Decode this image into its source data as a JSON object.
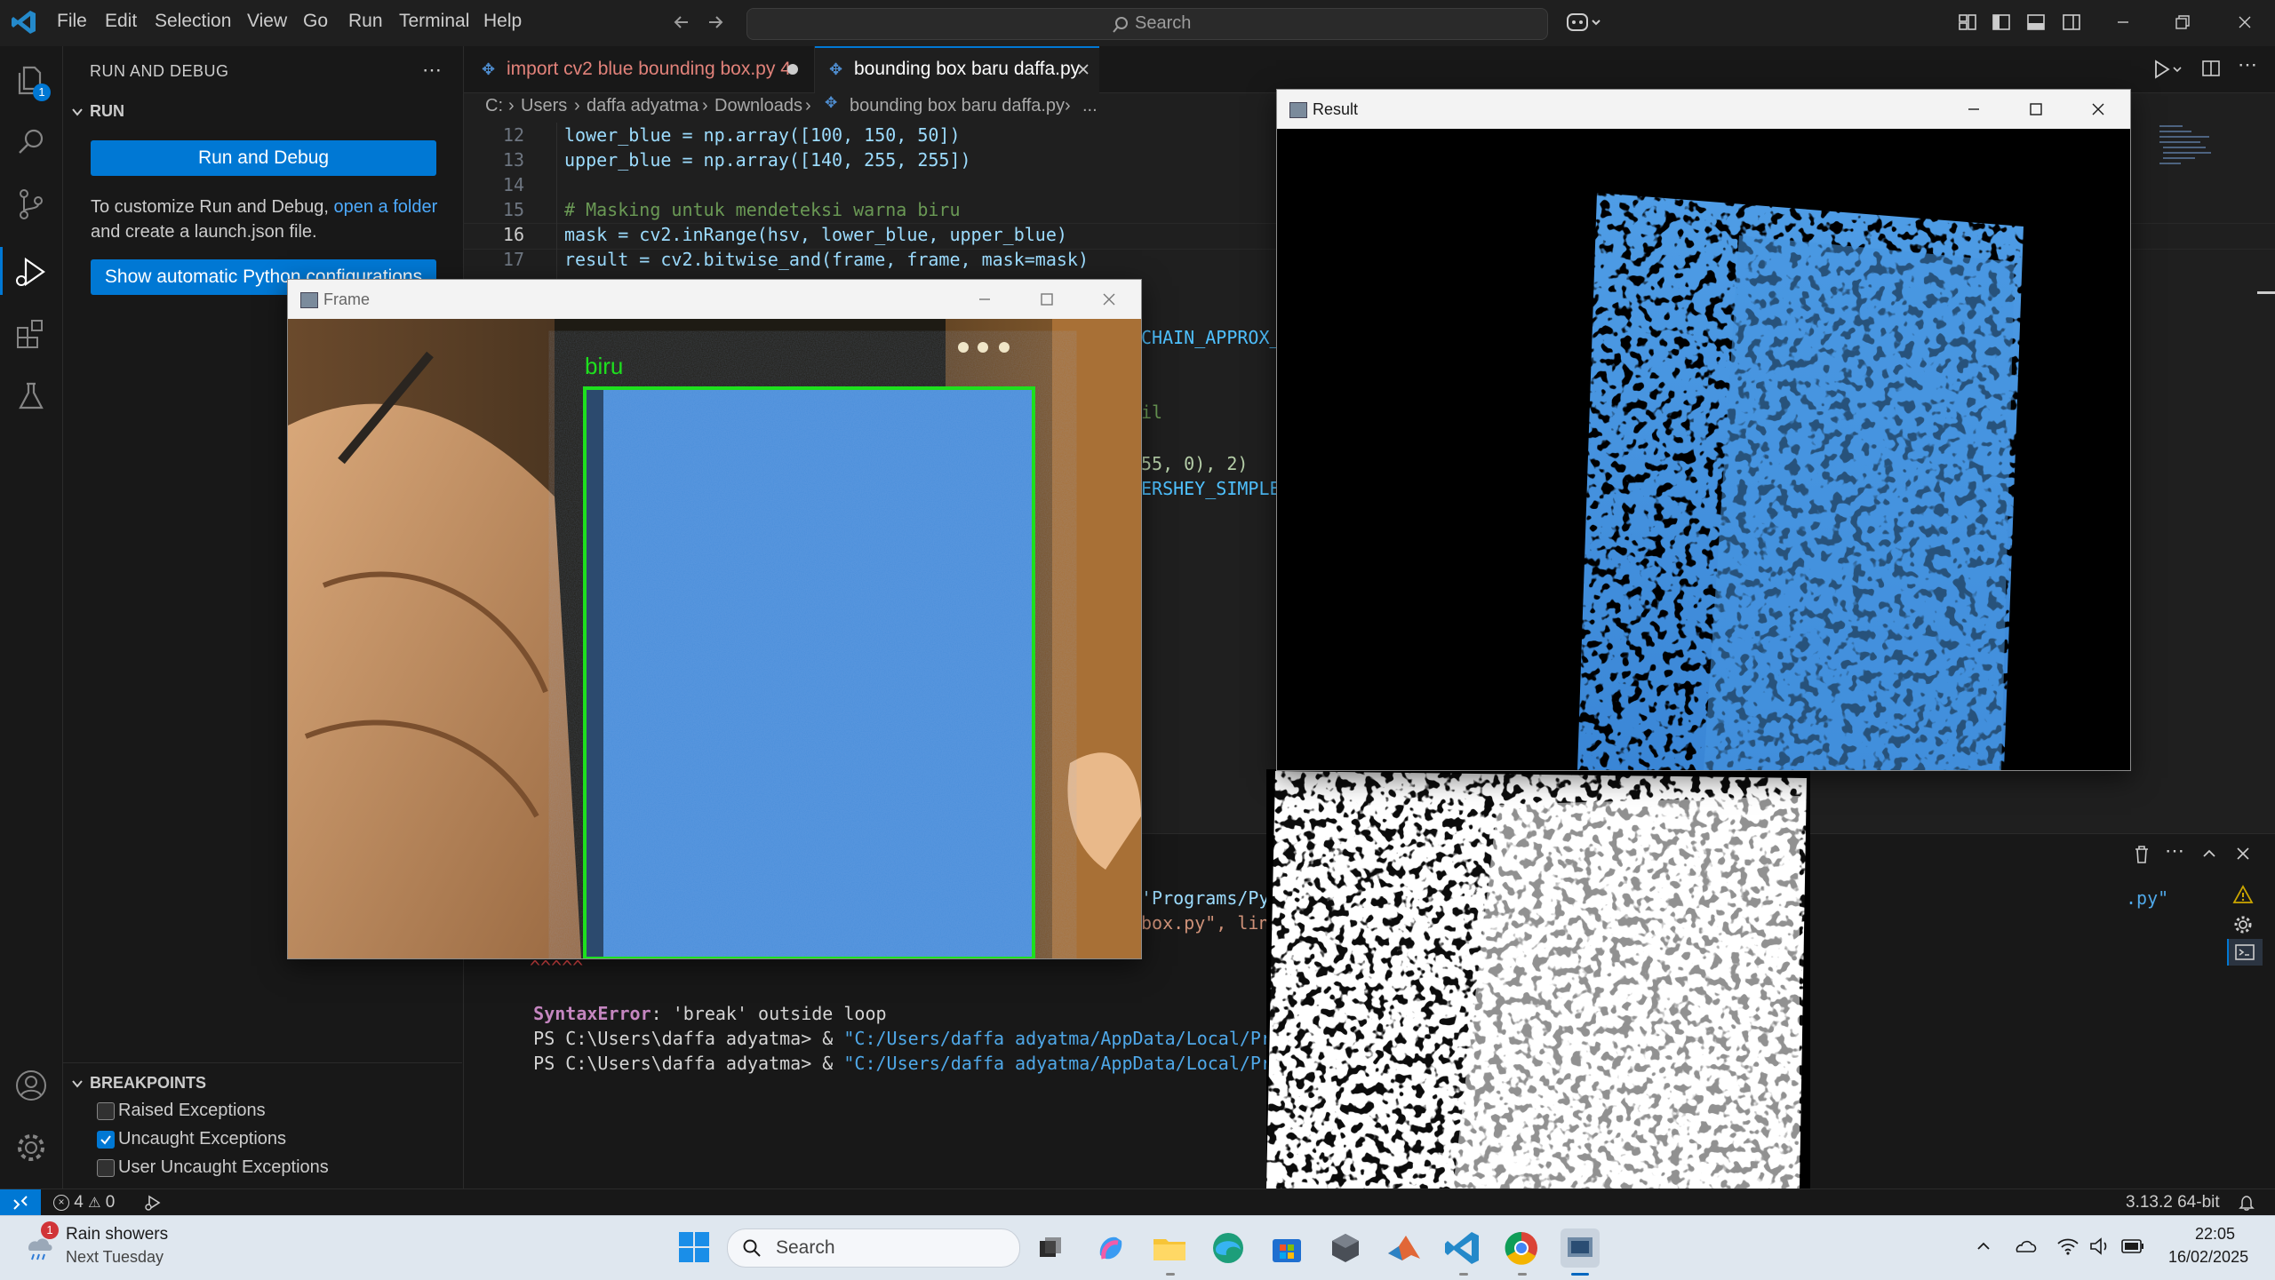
{
  "titlebar": {
    "menu": [
      "File",
      "Edit",
      "Selection",
      "View",
      "Go",
      "Run",
      "Terminal",
      "Help"
    ],
    "search_placeholder": "Search"
  },
  "activity_bar": {
    "explorer_badge": "1"
  },
  "sidebar": {
    "title": "RUN AND DEBUG",
    "section_run": "RUN",
    "run_button": "Run and Debug",
    "customize_text_1": "To customize Run and Debug,",
    "customize_link": "open a folder",
    "customize_text_2": "and create a launch.json file.",
    "python_button": "Show automatic Python configurations",
    "breakpoints_title": "BREAKPOINTS",
    "breakpoints": [
      {
        "label": "Raised Exceptions",
        "checked": false
      },
      {
        "label": "Uncaught Exceptions",
        "checked": true
      },
      {
        "label": "User Uncaught Exceptions",
        "checked": false
      }
    ]
  },
  "tabs": [
    {
      "label": "import cv2 blue bounding box.py 4",
      "modified": true
    },
    {
      "label": "bounding box baru daffa.py",
      "active": true
    }
  ],
  "breadcrumb": {
    "drive": "C:",
    "parts": [
      "Users",
      "daffa adyatma",
      "Downloads"
    ],
    "file": "bounding box baru daffa.py",
    "more": "..."
  },
  "editor": {
    "lines": [
      {
        "num": "12",
        "text": "lower_blue = np.array([100, 150, 50])"
      },
      {
        "num": "13",
        "text": "upper_blue = np.array([140, 255, 255])"
      },
      {
        "num": "14",
        "text": ""
      },
      {
        "num": "15",
        "text": "# Masking untuk mendeteksi warna biru"
      },
      {
        "num": "16",
        "text": "mask = cv2.inRange(hsv, lower_blue, upper_blue)"
      },
      {
        "num": "17",
        "text": "result = cv2.bitwise_and(frame, frame, mask=mask)"
      }
    ],
    "partial_right": [
      "CHAIN_APPROX_S",
      "il",
      "55, 0), 2)",
      "ERSHEY_SIMPLEX"
    ]
  },
  "terminal": {
    "partial_lines": [
      "'Programs/Pyth",
      "box.py\", line"
    ],
    "carets": "^^^^^",
    "error_type": "SyntaxError",
    "error_msg": ": 'break' outside loop",
    "prompt": "PS C:\\Users\\daffa adyatma> & ",
    "cmd": "\"C:/Users/daffa adyatma/AppData/Local/Programs/Pyth",
    "right_partial": ".py\""
  },
  "frame_window": {
    "title": "Frame",
    "label": "biru"
  },
  "result_window": {
    "title": "Result"
  },
  "statusbar": {
    "errors": "4",
    "warnings": "0",
    "python_version": "3.13.2 64-bit"
  },
  "taskbar": {
    "weather_badge": "1",
    "weather_title": "Rain showers",
    "weather_sub": "Next Tuesday",
    "search": "Search",
    "time": "22:05",
    "date": "16/02/2025"
  },
  "colors": {
    "accent": "#0078d4",
    "bbox": "#1ee01e",
    "blue_region": "#3f8fe0"
  }
}
